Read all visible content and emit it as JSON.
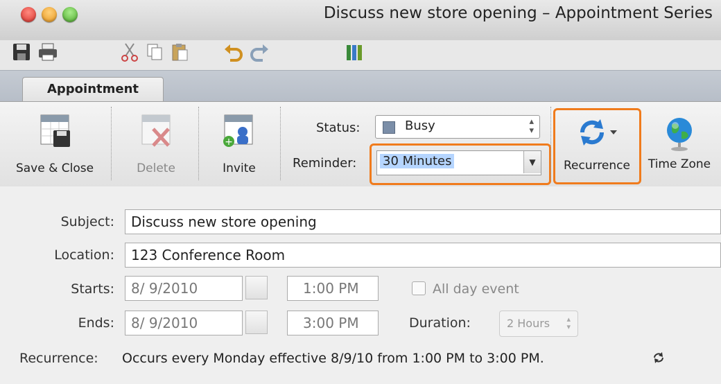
{
  "window": {
    "title": "Discuss new store opening – Appointment Series"
  },
  "quick_access": {
    "icons": [
      "save-icon",
      "print-icon",
      "cut-icon",
      "copy-icon",
      "paste-icon",
      "undo-icon",
      "redo-icon",
      "office-icon"
    ]
  },
  "tabs": [
    {
      "label": "Appointment",
      "active": true
    }
  ],
  "ribbon": {
    "save_close": "Save & Close",
    "delete": "Delete",
    "invite": "Invite",
    "status_label": "Status:",
    "status_value": "Busy",
    "reminder_label": "Reminder:",
    "reminder_value": "30 Minutes",
    "recurrence": "Recurrence",
    "time_zone": "Time Zone"
  },
  "form": {
    "subject_label": "Subject:",
    "subject_value": "Discuss new store opening",
    "location_label": "Location:",
    "location_value": "123 Conference Room",
    "starts_label": "Starts:",
    "starts_date": "8/ 9/2010",
    "starts_time": "1:00 PM",
    "all_day_label": "All day event",
    "ends_label": "Ends:",
    "ends_date": "8/ 9/2010",
    "ends_time": "3:00 PM",
    "duration_label": "Duration:",
    "duration_value": "2 Hours",
    "recurrence_label": "Recurrence:",
    "recurrence_text": "Occurs every Monday effective 8/9/10 from 1:00 PM to 3:00 PM."
  },
  "colors": {
    "highlight": "#f07b1c",
    "close": "#e0443e",
    "minimize": "#f0a030",
    "zoom": "#5fbf3c",
    "selection": "#b5d5ff"
  }
}
